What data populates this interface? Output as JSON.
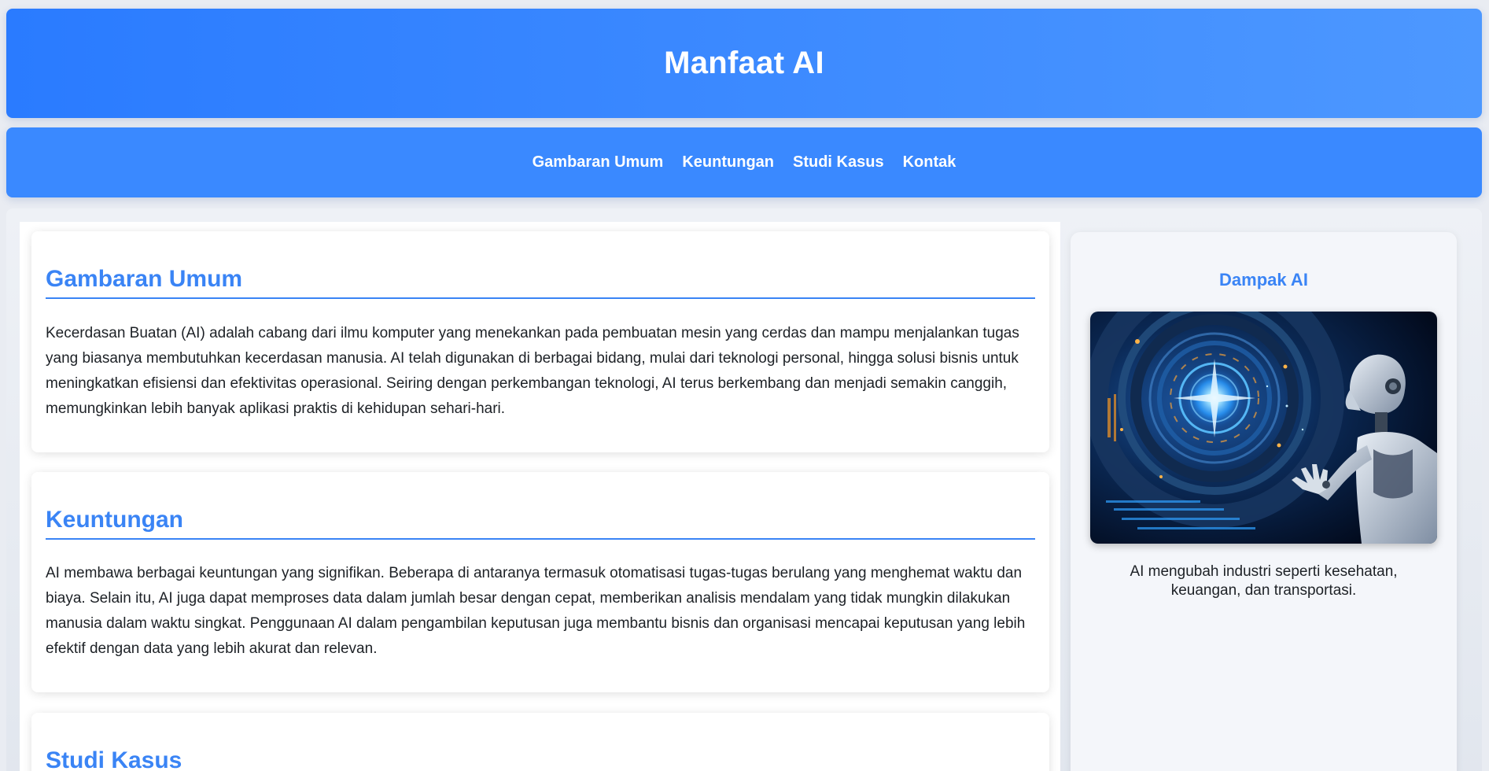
{
  "header": {
    "title": "Manfaat AI"
  },
  "nav": {
    "items": [
      {
        "label": "Gambaran Umum"
      },
      {
        "label": "Keuntungan"
      },
      {
        "label": "Studi Kasus"
      },
      {
        "label": "Kontak"
      }
    ]
  },
  "sections": [
    {
      "title": "Gambaran Umum",
      "body": "Kecerdasan Buatan (AI) adalah cabang dari ilmu komputer yang menekankan pada pembuatan mesin yang cerdas dan mampu menjalankan tugas yang biasanya membutuhkan kecerdasan manusia. AI telah digunakan di berbagai bidang, mulai dari teknologi personal, hingga solusi bisnis untuk meningkatkan efisiensi dan efektivitas operasional. Seiring dengan perkembangan teknologi, AI terus berkembang dan menjadi semakin canggih, memungkinkan lebih banyak aplikasi praktis di kehidupan sehari-hari."
    },
    {
      "title": "Keuntungan",
      "body": "AI membawa berbagai keuntungan yang signifikan. Beberapa di antaranya termasuk otomatisasi tugas-tugas berulang yang menghemat waktu dan biaya. Selain itu, AI juga dapat memproses data dalam jumlah besar dengan cepat, memberikan analisis mendalam yang tidak mungkin dilakukan manusia dalam waktu singkat. Penggunaan AI dalam pengambilan keputusan juga membantu bisnis dan organisasi mencapai keputusan yang lebih efektif dengan data yang lebih akurat dan relevan."
    },
    {
      "title": "Studi Kasus"
    }
  ],
  "sidebar": {
    "title": "Dampak AI",
    "caption": "AI mengubah industri seperti kesehatan, keuangan, dan transportasi."
  },
  "colors": {
    "accent": "#3a84f5",
    "header_bg": "#2a7bff",
    "nav_bg": "#3a89ff"
  }
}
